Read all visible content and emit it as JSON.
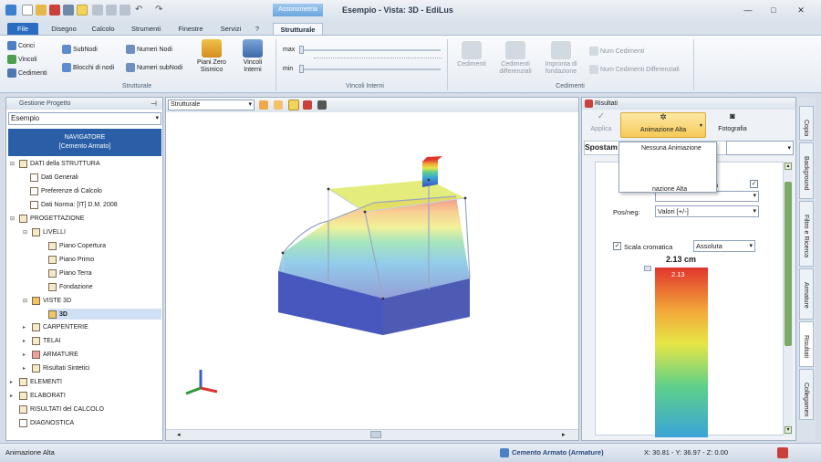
{
  "window": {
    "title": "Esempio  -  Vista: 3D - EdiLus",
    "context_tab": "Assonometria"
  },
  "tabs": [
    {
      "label": "File"
    },
    {
      "label": "Disegno"
    },
    {
      "label": "Calcolo"
    },
    {
      "label": "Strumenti"
    },
    {
      "label": "Finestre"
    },
    {
      "label": "Servizi"
    },
    {
      "label": "?"
    },
    {
      "label": "Strutturale"
    }
  ],
  "ribbon": {
    "strutturale": {
      "label": "Strutturale",
      "conci": "Conci",
      "vincoli": "Vincoli",
      "cedimenti": "Cedimenti",
      "subnodi": "SubNodi",
      "blocchi_nodi": "Blocchi di nodi",
      "numeri_nodi": "Numeri Nodi",
      "numeri_subnodi": "Numeri subNodi",
      "piani_zero_1": "Piani Zero",
      "piani_zero_2": "Sismico",
      "vincoli_int_1": "Vincoli",
      "vincoli_int_2": "Interni"
    },
    "vincoli_interni": {
      "label": "Vincoli Interni",
      "max": "max",
      "min": "min"
    },
    "cedimenti": {
      "label": "Cedimenti",
      "cedimenti": "Cedimenti",
      "ced_diff_1": "Cedimenti",
      "ced_diff_2": "differenziali",
      "impronta_1": "Impronta di",
      "impronta_2": "fondazione",
      "num_ced": "Num Cedimenti",
      "num_ced_diff": "Num Cedimenti Differenziali"
    }
  },
  "left_panel": {
    "title": "Gestione Progetto",
    "project": "Esempio",
    "banner_1": "NAVIGATORE",
    "banner_2": "[Cemento Armato]",
    "tree": [
      {
        "label": "DATI della STRUTTURA"
      },
      {
        "label": "Dati Generali"
      },
      {
        "label": "Preferenze di Calcolo"
      },
      {
        "label": "Dati Norma: [IT] D.M. 2008"
      },
      {
        "label": "PROGETTAZIONE"
      },
      {
        "label": "LIVELLI"
      },
      {
        "label": "Piano Copertura"
      },
      {
        "label": "Piano Primo"
      },
      {
        "label": "Piano Terra"
      },
      {
        "label": "Fondazione"
      },
      {
        "label": "VISTE 3D"
      },
      {
        "label": "3D"
      },
      {
        "label": "CARPENTERIE"
      },
      {
        "label": "TELAI"
      },
      {
        "label": "ARMATURE"
      },
      {
        "label": "Risultati Sintetici"
      },
      {
        "label": "ELEMENTI"
      },
      {
        "label": "ELABORATI"
      },
      {
        "label": "RISULTATI del CALCOLO"
      },
      {
        "label": "DIAGNOSTICA"
      }
    ]
  },
  "view": {
    "combo": "Strutturale"
  },
  "right_panel": {
    "title": "Risultati",
    "applica": "Applica",
    "animazione": "Animazione Alta",
    "fotografia": "Fotografia",
    "spostam": "Spostam",
    "dropdown_item_1": "Nessuna Animazione",
    "dropdown_item_2": "nazione Alta",
    "struttura_partial": "uttura",
    "posneg_label": "Pos/neg:",
    "posneg_value": "Valori  [+/-]",
    "scala_label": "Scala cromatica",
    "scala_mode": "Assoluta",
    "max_value": "2.13 cm",
    "bar_value": "2.13"
  },
  "vertical_tabs": [
    "Copia",
    "Background",
    "Filtro e Ricerca",
    "Armature",
    "Risultati",
    "Collegamen"
  ],
  "status": {
    "left": "Animazione Alta",
    "material": "Cemento Armato (Armature)",
    "coords": "X: 30.81 - Y: 36.97 - Z: 0.00"
  }
}
